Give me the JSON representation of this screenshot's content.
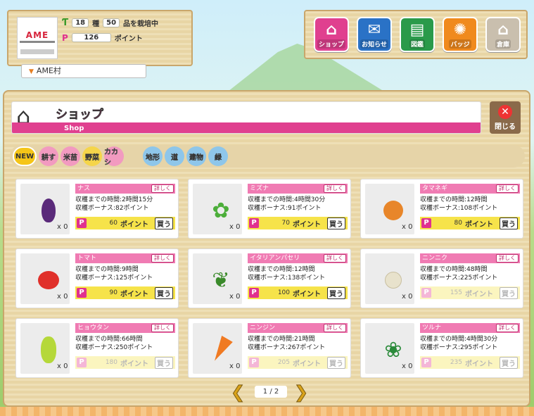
{
  "profile": {
    "logo_text": "AME",
    "seeds_count": "18",
    "seeds_label": "種",
    "crops_count": "50",
    "crops_label": "品を栽培中",
    "points_value": "126",
    "points_label": "ポイント",
    "village": "AME村"
  },
  "nav": [
    {
      "label": "ショップ",
      "icon": "shop-icon",
      "color": "#e0408f",
      "active": true
    },
    {
      "label": "お知らせ",
      "icon": "mail-icon",
      "color": "#2a72c6",
      "active": false
    },
    {
      "label": "図鑑",
      "icon": "book-icon",
      "color": "#2a9a4a",
      "active": false
    },
    {
      "label": "バッジ",
      "icon": "badge-icon",
      "color": "#f08a1e",
      "active": false
    },
    {
      "label": "倉庫",
      "icon": "warehouse-icon",
      "color": "#c9bfae",
      "active": false
    }
  ],
  "header": {
    "title": "ショップ",
    "subtitle": "Shop",
    "close_label": "閉じる"
  },
  "filters": [
    "NEW",
    "耕す",
    "米苗",
    "野菜",
    "カカシ",
    "地形",
    "道",
    "建物",
    "緑"
  ],
  "items": [
    {
      "name": "ナス",
      "time": "収穫までの時間:2時間15分",
      "bonus": "収穫ボーナス:82ポイント",
      "price": "60",
      "qty": "x 0",
      "available": true,
      "veg_color": "#5a2a7a",
      "veg_icon": "eggplant-icon"
    },
    {
      "name": "ミズナ",
      "time": "収穫までの時間:4時間30分",
      "bonus": "収穫ボーナス:91ポイント",
      "price": "70",
      "qty": "x 0",
      "available": true,
      "veg_color": "#4cae3a",
      "veg_icon": "mizuna-icon"
    },
    {
      "name": "タマネギ",
      "time": "収穫までの時間:12時間",
      "bonus": "収穫ボーナス:108ポイント",
      "price": "80",
      "qty": "x 0",
      "available": true,
      "veg_color": "#e8862a",
      "veg_icon": "onion-icon"
    },
    {
      "name": "トマト",
      "time": "収穫までの時間:9時間",
      "bonus": "収穫ボーナス:125ポイント",
      "price": "90",
      "qty": "x 0",
      "available": true,
      "veg_color": "#e0302a",
      "veg_icon": "tomato-icon"
    },
    {
      "name": "イタリアンパセリ",
      "time": "収穫までの時間:12時間",
      "bonus": "収穫ボーナス:138ポイント",
      "price": "100",
      "qty": "x 0",
      "available": true,
      "veg_color": "#3a8a2a",
      "veg_icon": "parsley-icon"
    },
    {
      "name": "ニンニク",
      "time": "収穫までの時間:48時間",
      "bonus": "収穫ボーナス:225ポイント",
      "price": "155",
      "qty": "x 0",
      "available": false,
      "veg_color": "#e8e2cc",
      "veg_icon": "garlic-icon"
    },
    {
      "name": "ヒョウタン",
      "time": "収穫までの時間:66時間",
      "bonus": "収穫ボーナス:250ポイント",
      "price": "180",
      "qty": "x 0",
      "available": false,
      "veg_color": "#b5d83a",
      "veg_icon": "gourd-icon"
    },
    {
      "name": "ニンジン",
      "time": "収穫までの時間:21時間",
      "bonus": "収穫ボーナス:267ポイント",
      "price": "205",
      "qty": "x 0",
      "available": false,
      "veg_color": "#f07a22",
      "veg_icon": "carrot-icon"
    },
    {
      "name": "ツルナ",
      "time": "収穫までの時間:4時間30分",
      "bonus": "収穫ボーナス:295ポイント",
      "price": "235",
      "qty": "x 0",
      "available": false,
      "veg_color": "#2a8a3a",
      "veg_icon": "tsuruna-icon"
    }
  ],
  "labels": {
    "detail": "詳しく",
    "point": "ポイント",
    "buy": "買う",
    "p": "P"
  },
  "pager": {
    "current": "1",
    "total": "2",
    "separator": "/"
  }
}
